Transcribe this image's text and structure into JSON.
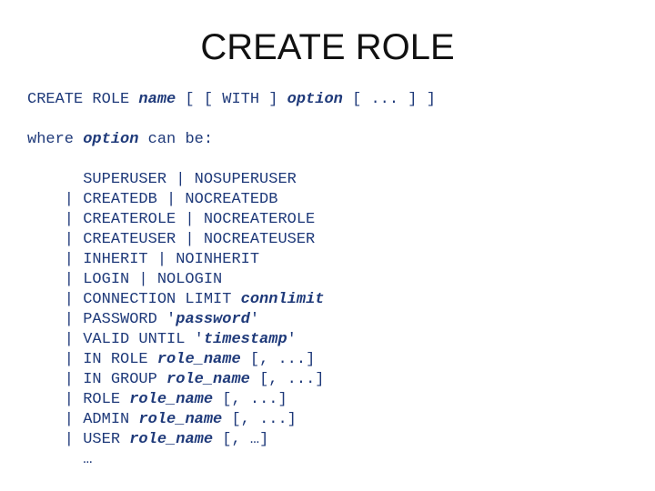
{
  "title": "CREATE ROLE",
  "syntax": {
    "lead": "CREATE ROLE ",
    "name": "name",
    "rest": " [ [ WITH ] ",
    "option": "option",
    "tail": " [ ... ] ]"
  },
  "where": {
    "prefix": "where ",
    "option": "option",
    "suffix": " can be:"
  },
  "opts": {
    "superuser": "SUPERUSER | NOSUPERUSER",
    "createdb": "CREATEDB | NOCREATEDB",
    "createrole": "CREATEROLE | NOCREATEROLE",
    "createuser": "CREATEUSER | NOCREATEUSER",
    "inherit": "INHERIT | NOINHERIT",
    "login": "LOGIN | NOLOGIN",
    "connlimit_kw": "CONNECTION LIMIT ",
    "connlimit": "connlimit",
    "password_kw": "PASSWORD '",
    "password": "password",
    "validuntil_kw": "VALID UNTIL '",
    "timestamp": "timestamp",
    "close_quote": "'",
    "inrole_kw": "IN ROLE ",
    "ingroup_kw": "IN GROUP ",
    "role_kw": "ROLE ",
    "admin_kw": "ADMIN ",
    "user_kw": "USER ",
    "role_name": "role_name",
    "list_tail": " [, ...]",
    "list_tail_ellipsis": " [, …]",
    "ellipsis": "…"
  },
  "indent": {
    "first": "      ",
    "bar": "    | ",
    "last": "      "
  }
}
